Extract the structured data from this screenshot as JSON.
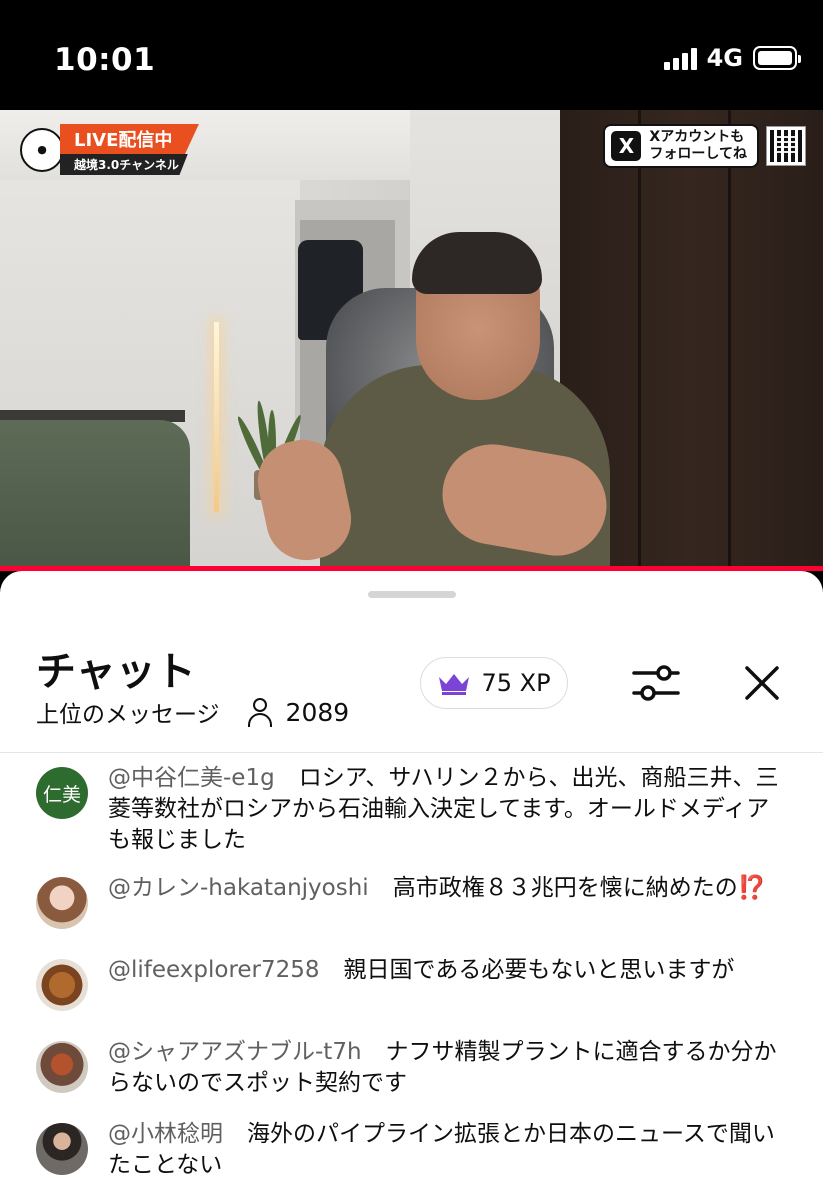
{
  "status_bar": {
    "time": "10:01",
    "network": "4G"
  },
  "video": {
    "live_label": "LIVE配信中",
    "channel_label": "越境3.0チャンネル",
    "follow_line1": "Xアカウントも",
    "follow_line2": "フォローしてね",
    "x_logo": "X"
  },
  "chat": {
    "title": "チャット",
    "mode_label": "上位のメッセージ",
    "viewer_count": "2089",
    "xp_label": "75 XP",
    "messages": [
      {
        "avatar_text": "仁美",
        "author": "@中谷仁美-e1g",
        "text": "ロシア、サハリン２から、出光、商船三井、三菱等数社がロシアから石油輸入決定してます。オールドメディアも報じました"
      },
      {
        "avatar_text": "",
        "author": "@カレン-hakatanjyoshi",
        "text": "高市政権８３兆円を懐に納めたの",
        "emoji": "⁉️"
      },
      {
        "avatar_text": "",
        "author": "@lifeexplorer7258",
        "text": "親日国である必要もないと思いますが"
      },
      {
        "avatar_text": "",
        "author": "@シャアアズナブル-t7h",
        "text": "ナフサ精製プラントに適合するか分からないのでスポット契約です"
      },
      {
        "avatar_text": "",
        "author": "@小林稔明",
        "text": "海外のパイプライン拡張とか日本のニュースで聞いたことない"
      }
    ]
  },
  "colors": {
    "live_orange": "#ea4f1f",
    "progress_red": "#ff0033",
    "crown_purple": "#7b44d6",
    "avatar_green": "#2e6b2f"
  }
}
